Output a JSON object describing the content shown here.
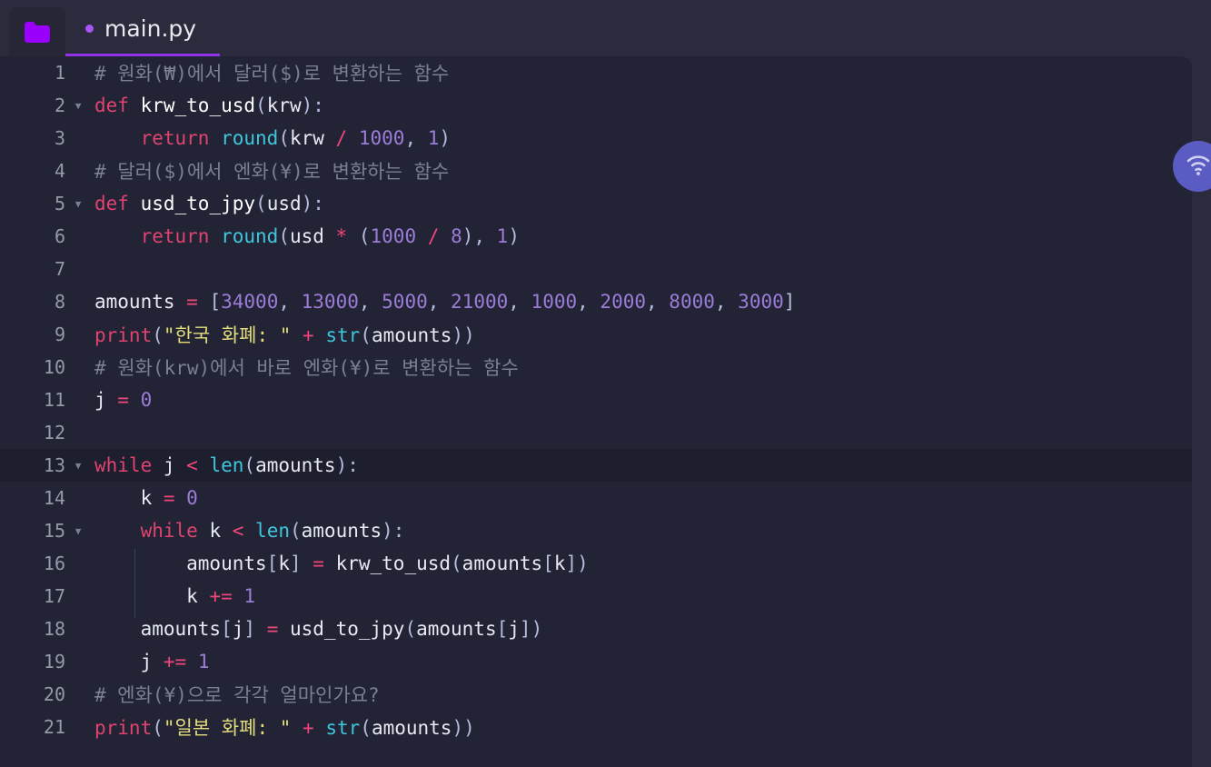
{
  "window": {
    "background_color": "#2b2b3d",
    "editor_background_color": "#222436",
    "accent_color": "#9333ea"
  },
  "topbar": {
    "folder_button": {
      "icon": "folder-icon",
      "color": "#9b00ff"
    },
    "tabs": [
      {
        "label": "main.py",
        "modified": true,
        "active": true,
        "dot_color": "#a855f7",
        "underline_color": "#9333ea"
      }
    ]
  },
  "assist_button": {
    "icon": "wifi-signal-icon",
    "color": "#5b5bc4"
  },
  "editor": {
    "language": "python",
    "active_line": 13,
    "first_visible_line": 1,
    "last_visible_line": 21,
    "lines": [
      {
        "number": "1",
        "fold": false,
        "text": "# 원화(₩)에서 달러($)로 변환하는 함수"
      },
      {
        "number": "2",
        "fold": true,
        "text": "def krw_to_usd(krw):"
      },
      {
        "number": "3",
        "fold": false,
        "text": "    return round(krw / 1000, 1)"
      },
      {
        "number": "4",
        "fold": false,
        "text": "# 달러($)에서 엔화(¥)로 변환하는 함수"
      },
      {
        "number": "5",
        "fold": true,
        "text": "def usd_to_jpy(usd):"
      },
      {
        "number": "6",
        "fold": false,
        "text": "    return round(usd * (1000 / 8), 1)"
      },
      {
        "number": "7",
        "fold": false,
        "text": ""
      },
      {
        "number": "8",
        "fold": false,
        "text": "amounts = [34000, 13000, 5000, 21000, 1000, 2000, 8000, 3000]"
      },
      {
        "number": "9",
        "fold": false,
        "text": "print(\"한국 화폐: \" + str(amounts))"
      },
      {
        "number": "10",
        "fold": false,
        "text": "# 원화(krw)에서 바로 엔화(¥)로 변환하는 함수"
      },
      {
        "number": "11",
        "fold": false,
        "text": "j = 0"
      },
      {
        "number": "12",
        "fold": false,
        "text": ""
      },
      {
        "number": "13",
        "fold": true,
        "text": "while j < len(amounts):"
      },
      {
        "number": "14",
        "fold": false,
        "text": "    k = 0"
      },
      {
        "number": "15",
        "fold": true,
        "text": "    while k < len(amounts):"
      },
      {
        "number": "16",
        "fold": false,
        "text": "        amounts[k] = krw_to_usd(amounts[k])"
      },
      {
        "number": "17",
        "fold": false,
        "text": "        k += 1"
      },
      {
        "number": "18",
        "fold": false,
        "text": "    amounts[j] = usd_to_jpy(amounts[j])"
      },
      {
        "number": "19",
        "fold": false,
        "text": "    j += 1"
      },
      {
        "number": "20",
        "fold": false,
        "text": "# 엔화(¥)으로 각각 얼마인가요?"
      },
      {
        "number": "21",
        "fold": false,
        "text": "print(\"일본 화폐: \" + str(amounts))"
      }
    ],
    "tokens": [
      [
        {
          "c": "t-comment",
          "s": "# 원화(₩)에서 달러($)로 변환하는 함수"
        }
      ],
      [
        {
          "c": "t-kw",
          "s": "def"
        },
        {
          "c": "t-plain",
          "s": " "
        },
        {
          "c": "t-fn",
          "s": "krw_to_usd"
        },
        {
          "c": "t-punct",
          "s": "("
        },
        {
          "c": "t-plain",
          "s": "krw"
        },
        {
          "c": "t-punct",
          "s": "):"
        }
      ],
      [
        {
          "c": "t-plain",
          "s": "    "
        },
        {
          "c": "t-kw",
          "s": "return"
        },
        {
          "c": "t-plain",
          "s": " "
        },
        {
          "c": "t-builtin",
          "s": "round"
        },
        {
          "c": "t-punct",
          "s": "("
        },
        {
          "c": "t-plain",
          "s": "krw "
        },
        {
          "c": "t-op",
          "s": "/"
        },
        {
          "c": "t-plain",
          "s": " "
        },
        {
          "c": "t-num",
          "s": "1000"
        },
        {
          "c": "t-punct",
          "s": ", "
        },
        {
          "c": "t-num",
          "s": "1"
        },
        {
          "c": "t-punct",
          "s": ")"
        }
      ],
      [
        {
          "c": "t-comment",
          "s": "# 달러($)에서 엔화(¥)로 변환하는 함수"
        }
      ],
      [
        {
          "c": "t-kw",
          "s": "def"
        },
        {
          "c": "t-plain",
          "s": " "
        },
        {
          "c": "t-fn",
          "s": "usd_to_jpy"
        },
        {
          "c": "t-punct",
          "s": "("
        },
        {
          "c": "t-plain",
          "s": "usd"
        },
        {
          "c": "t-punct",
          "s": "):"
        }
      ],
      [
        {
          "c": "t-plain",
          "s": "    "
        },
        {
          "c": "t-kw",
          "s": "return"
        },
        {
          "c": "t-plain",
          "s": " "
        },
        {
          "c": "t-builtin",
          "s": "round"
        },
        {
          "c": "t-punct",
          "s": "("
        },
        {
          "c": "t-plain",
          "s": "usd "
        },
        {
          "c": "t-op",
          "s": "*"
        },
        {
          "c": "t-plain",
          "s": " "
        },
        {
          "c": "t-punct",
          "s": "("
        },
        {
          "c": "t-num",
          "s": "1000"
        },
        {
          "c": "t-plain",
          "s": " "
        },
        {
          "c": "t-op",
          "s": "/"
        },
        {
          "c": "t-plain",
          "s": " "
        },
        {
          "c": "t-num",
          "s": "8"
        },
        {
          "c": "t-punct",
          "s": "), "
        },
        {
          "c": "t-num",
          "s": "1"
        },
        {
          "c": "t-punct",
          "s": ")"
        }
      ],
      [],
      [
        {
          "c": "t-plain",
          "s": "amounts "
        },
        {
          "c": "t-op",
          "s": "="
        },
        {
          "c": "t-plain",
          "s": " "
        },
        {
          "c": "t-punct",
          "s": "["
        },
        {
          "c": "t-num",
          "s": "34000"
        },
        {
          "c": "t-punct",
          "s": ", "
        },
        {
          "c": "t-num",
          "s": "13000"
        },
        {
          "c": "t-punct",
          "s": ", "
        },
        {
          "c": "t-num",
          "s": "5000"
        },
        {
          "c": "t-punct",
          "s": ", "
        },
        {
          "c": "t-num",
          "s": "21000"
        },
        {
          "c": "t-punct",
          "s": ", "
        },
        {
          "c": "t-num",
          "s": "1000"
        },
        {
          "c": "t-punct",
          "s": ", "
        },
        {
          "c": "t-num",
          "s": "2000"
        },
        {
          "c": "t-punct",
          "s": ", "
        },
        {
          "c": "t-num",
          "s": "8000"
        },
        {
          "c": "t-punct",
          "s": ", "
        },
        {
          "c": "t-num",
          "s": "3000"
        },
        {
          "c": "t-punct",
          "s": "]"
        }
      ],
      [
        {
          "c": "t-print",
          "s": "print"
        },
        {
          "c": "t-punct",
          "s": "("
        },
        {
          "c": "t-str",
          "s": "\"한국 화폐: \""
        },
        {
          "c": "t-plain",
          "s": " "
        },
        {
          "c": "t-op",
          "s": "+"
        },
        {
          "c": "t-plain",
          "s": " "
        },
        {
          "c": "t-builtin",
          "s": "str"
        },
        {
          "c": "t-punct",
          "s": "("
        },
        {
          "c": "t-plain",
          "s": "amounts"
        },
        {
          "c": "t-punct",
          "s": "))"
        }
      ],
      [
        {
          "c": "t-comment",
          "s": "# 원화(krw)에서 바로 엔화(¥)로 변환하는 함수"
        }
      ],
      [
        {
          "c": "t-plain",
          "s": "j "
        },
        {
          "c": "t-op",
          "s": "="
        },
        {
          "c": "t-plain",
          "s": " "
        },
        {
          "c": "t-num",
          "s": "0"
        }
      ],
      [],
      [
        {
          "c": "t-kw",
          "s": "while"
        },
        {
          "c": "t-plain",
          "s": " j "
        },
        {
          "c": "t-op",
          "s": "<"
        },
        {
          "c": "t-plain",
          "s": " "
        },
        {
          "c": "t-builtin",
          "s": "len"
        },
        {
          "c": "t-punct",
          "s": "("
        },
        {
          "c": "t-plain",
          "s": "amounts"
        },
        {
          "c": "t-punct",
          "s": "):"
        }
      ],
      [
        {
          "c": "t-plain",
          "s": "    k "
        },
        {
          "c": "t-op",
          "s": "="
        },
        {
          "c": "t-plain",
          "s": " "
        },
        {
          "c": "t-num",
          "s": "0"
        }
      ],
      [
        {
          "c": "t-plain",
          "s": "    "
        },
        {
          "c": "t-kw",
          "s": "while"
        },
        {
          "c": "t-plain",
          "s": " k "
        },
        {
          "c": "t-op",
          "s": "<"
        },
        {
          "c": "t-plain",
          "s": " "
        },
        {
          "c": "t-builtin",
          "s": "len"
        },
        {
          "c": "t-punct",
          "s": "("
        },
        {
          "c": "t-plain",
          "s": "amounts"
        },
        {
          "c": "t-punct",
          "s": "):"
        }
      ],
      [
        {
          "c": "t-plain",
          "s": "        amounts"
        },
        {
          "c": "t-punct",
          "s": "["
        },
        {
          "c": "t-plain",
          "s": "k"
        },
        {
          "c": "t-punct",
          "s": "]"
        },
        {
          "c": "t-plain",
          "s": " "
        },
        {
          "c": "t-op",
          "s": "="
        },
        {
          "c": "t-plain",
          "s": " krw_to_usd"
        },
        {
          "c": "t-punct",
          "s": "("
        },
        {
          "c": "t-plain",
          "s": "amounts"
        },
        {
          "c": "t-punct",
          "s": "["
        },
        {
          "c": "t-plain",
          "s": "k"
        },
        {
          "c": "t-punct",
          "s": "])"
        }
      ],
      [
        {
          "c": "t-plain",
          "s": "        k "
        },
        {
          "c": "t-op",
          "s": "+="
        },
        {
          "c": "t-plain",
          "s": " "
        },
        {
          "c": "t-num",
          "s": "1"
        }
      ],
      [
        {
          "c": "t-plain",
          "s": "    amounts"
        },
        {
          "c": "t-punct",
          "s": "["
        },
        {
          "c": "t-plain",
          "s": "j"
        },
        {
          "c": "t-punct",
          "s": "]"
        },
        {
          "c": "t-plain",
          "s": " "
        },
        {
          "c": "t-op",
          "s": "="
        },
        {
          "c": "t-plain",
          "s": " usd_to_jpy"
        },
        {
          "c": "t-punct",
          "s": "("
        },
        {
          "c": "t-plain",
          "s": "amounts"
        },
        {
          "c": "t-punct",
          "s": "["
        },
        {
          "c": "t-plain",
          "s": "j"
        },
        {
          "c": "t-punct",
          "s": "])"
        }
      ],
      [
        {
          "c": "t-plain",
          "s": "    j "
        },
        {
          "c": "t-op",
          "s": "+="
        },
        {
          "c": "t-plain",
          "s": " "
        },
        {
          "c": "t-num",
          "s": "1"
        }
      ],
      [
        {
          "c": "t-comment",
          "s": "# 엔화(¥)으로 각각 얼마인가요?"
        }
      ],
      [
        {
          "c": "t-print",
          "s": "print"
        },
        {
          "c": "t-punct",
          "s": "("
        },
        {
          "c": "t-str",
          "s": "\"일본 화폐: \""
        },
        {
          "c": "t-plain",
          "s": " "
        },
        {
          "c": "t-op",
          "s": "+"
        },
        {
          "c": "t-plain",
          "s": " "
        },
        {
          "c": "t-builtin",
          "s": "str"
        },
        {
          "c": "t-punct",
          "s": "("
        },
        {
          "c": "t-plain",
          "s": "amounts"
        },
        {
          "c": "t-punct",
          "s": "))"
        }
      ]
    ]
  }
}
